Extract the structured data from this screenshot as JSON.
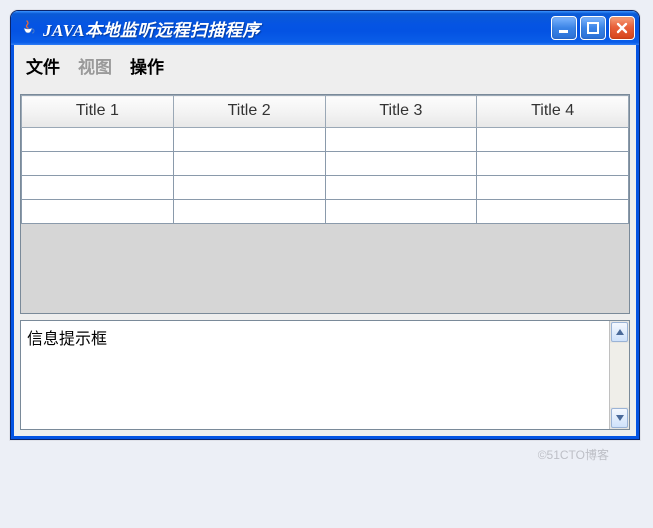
{
  "window": {
    "title": "JAVA本地监听远程扫描程序"
  },
  "menubar": {
    "file": "文件",
    "view": "视图",
    "operate": "操作"
  },
  "table": {
    "headers": [
      "Title 1",
      "Title 2",
      "Title 3",
      "Title 4"
    ],
    "rows": [
      [
        "",
        "",
        "",
        ""
      ],
      [
        "",
        "",
        "",
        ""
      ],
      [
        "",
        "",
        "",
        ""
      ],
      [
        "",
        "",
        "",
        ""
      ]
    ]
  },
  "message_box": {
    "text": "信息提示框"
  },
  "watermark": "©51CTO博客"
}
